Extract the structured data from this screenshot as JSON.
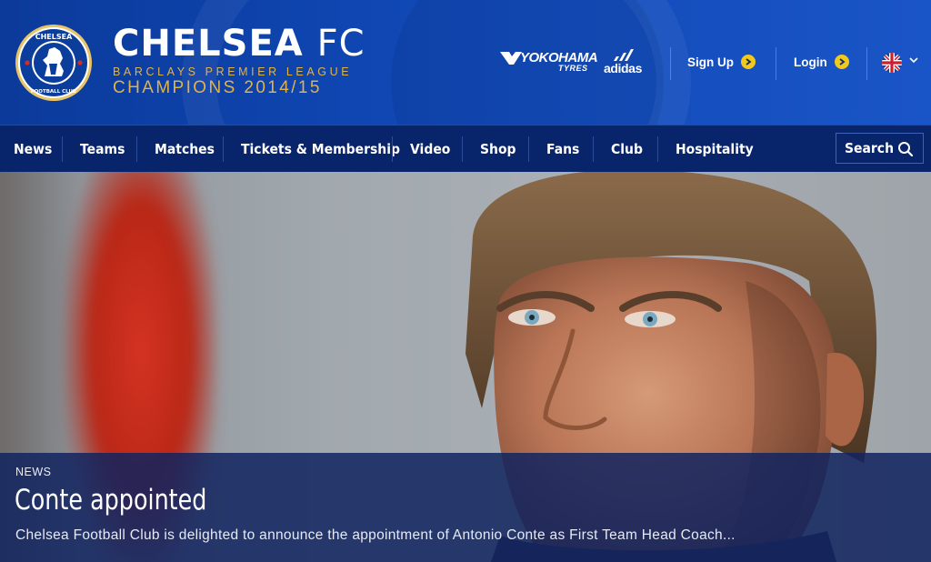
{
  "header": {
    "brand": {
      "title_main": "CHELSEA",
      "title_suffix": "FC",
      "subtitle_league": "BARCLAYS PREMIER LEAGUE",
      "subtitle_champions": "CHAMPIONS 2014/15",
      "crest_top_text": "CHELSEA",
      "crest_bottom_text": "FOOTBALL CLUB"
    },
    "sponsors": {
      "yokohama": "YOKOHAMA",
      "yokohama_sub": "TYRES",
      "adidas": "adidas"
    },
    "signup_label": "Sign Up",
    "login_label": "Login",
    "language_icon": "uk-flag-icon"
  },
  "nav": {
    "items": [
      "News",
      "Teams",
      "Matches",
      "Tickets & Membership",
      "Video",
      "Shop",
      "Fans",
      "Club",
      "Hospitality"
    ],
    "search_label": "Search"
  },
  "hero": {
    "tag": "NEWS",
    "title": "Conte appointed",
    "summary": "Chelsea Football Club is delighted to announce the appointment of Antonio Conte as First Team Head Coach..."
  },
  "colors": {
    "header_blue": "#1048b5",
    "nav_blue": "#08246a",
    "gold": "#e0b34a",
    "accent_yellow": "#f2c81b"
  }
}
